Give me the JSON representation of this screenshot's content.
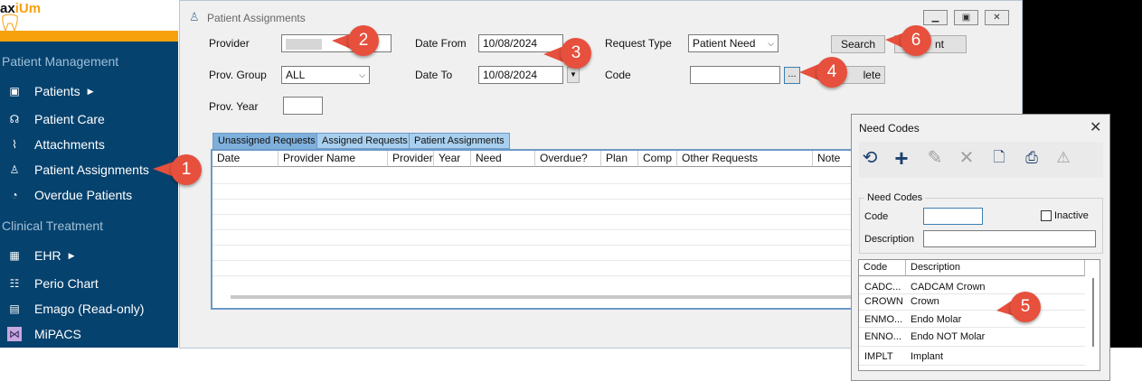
{
  "sidebar": {
    "logo_prefix": "ax",
    "logo_accent": "iUm",
    "section_patient_management": "Patient Management",
    "section_clinical_treatment": "Clinical Treatment",
    "items": [
      {
        "label": "Patients",
        "icon": "id-card-icon"
      },
      {
        "label": "Patient Care",
        "icon": "hands-icon"
      },
      {
        "label": "Attachments",
        "icon": "paperclip-icon"
      },
      {
        "label": "Patient Assignments",
        "icon": "user-assign-icon"
      },
      {
        "label": "Overdue Patients",
        "icon": "clock-icon"
      },
      {
        "label": "EHR",
        "icon": "ehr-icon"
      },
      {
        "label": "Perio Chart",
        "icon": "perio-icon"
      },
      {
        "label": "Emago (Read-only)",
        "icon": "xray-icon"
      },
      {
        "label": "MiPACS",
        "icon": "mipacs-icon"
      }
    ]
  },
  "window": {
    "title": "Patient Assignments",
    "form": {
      "provider_label": "Provider",
      "prov_group_label": "Prov. Group",
      "prov_group_value": "ALL",
      "prov_year_label": "Prov. Year",
      "prov_year_value": "",
      "date_from_label": "Date From",
      "date_from_value": "10/08/2024",
      "date_to_label": "Date To",
      "date_to_value": "10/08/2024",
      "request_type_label": "Request Type",
      "request_type_value": "Patient Need",
      "code_label": "Code",
      "code_value": "",
      "code_lookup_label": "...",
      "search_label": "Search",
      "print_label_fragment": "nt",
      "delete_label_fragment": "lete"
    },
    "tabs": [
      "Unassigned Requests",
      "Assigned Requests",
      "Patient Assignments"
    ],
    "columns": [
      "Date",
      "Provider Name",
      "Provider",
      "Year",
      "Need",
      "Overdue?",
      "Plan",
      "Comp",
      "Other Requests",
      "Note"
    ]
  },
  "dialog": {
    "title": "Need Codes",
    "close_label": "✕",
    "group_label": "Need Codes",
    "code_label": "Code",
    "code_value": "",
    "description_label": "Description",
    "description_value": "",
    "inactive_label": "Inactive",
    "list_columns": [
      "Code",
      "Description"
    ],
    "rows": [
      {
        "code": "CADC...",
        "description": "CADCAM Crown"
      },
      {
        "code": "CROWN",
        "description": "Crown"
      },
      {
        "code": "ENMO...",
        "description": "Endo Molar"
      },
      {
        "code": "ENNO...",
        "description": "Endo NOT Molar"
      },
      {
        "code": "IMPLT",
        "description": "Implant"
      }
    ]
  },
  "callouts": [
    "1",
    "2",
    "3",
    "4",
    "5",
    "6"
  ],
  "colors": {
    "sidebar_bg": "#06426e",
    "logo_orange": "#f7a10c",
    "callout": "#e6503d"
  }
}
